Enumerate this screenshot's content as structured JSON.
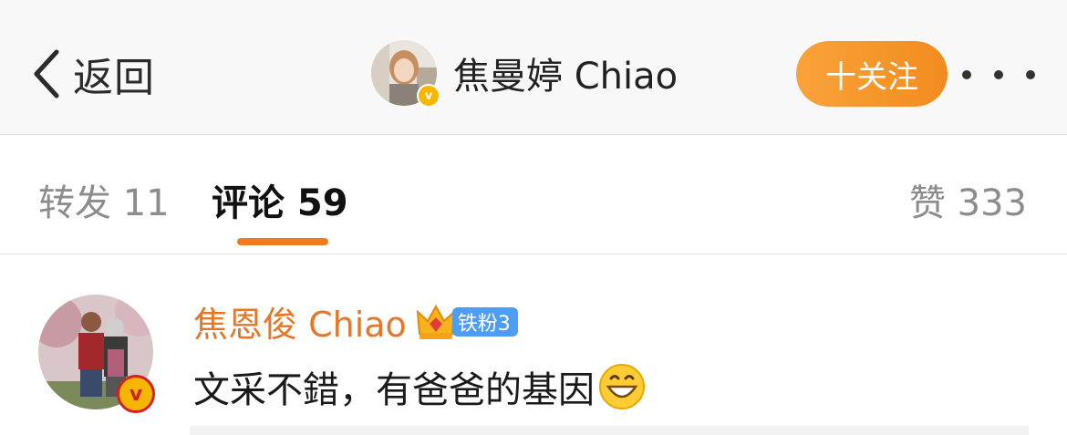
{
  "header": {
    "back_label": "返回",
    "profile_name": "焦曼婷 Chiao",
    "follow_label": "十关注"
  },
  "tabs": {
    "repost": "转发 11",
    "comment": "评论 59",
    "like": "赞 333"
  },
  "comment": {
    "author": "焦恩俊 Chiao",
    "fan_badge": "铁粉3",
    "text": "文采不錯，有爸爸的基因"
  },
  "colors": {
    "accent": "#f07c22",
    "follow_button": "#f28b1e",
    "author_name": "#e5772a",
    "fan_badge": "#4e9df5",
    "verified": "#f7b500"
  },
  "icons": {
    "back": "chevron-left-icon",
    "more": "more-dots-icon",
    "verified": "verified-v-icon",
    "crown": "crown-icon",
    "emoji": "grinning-face-emoji-icon"
  }
}
